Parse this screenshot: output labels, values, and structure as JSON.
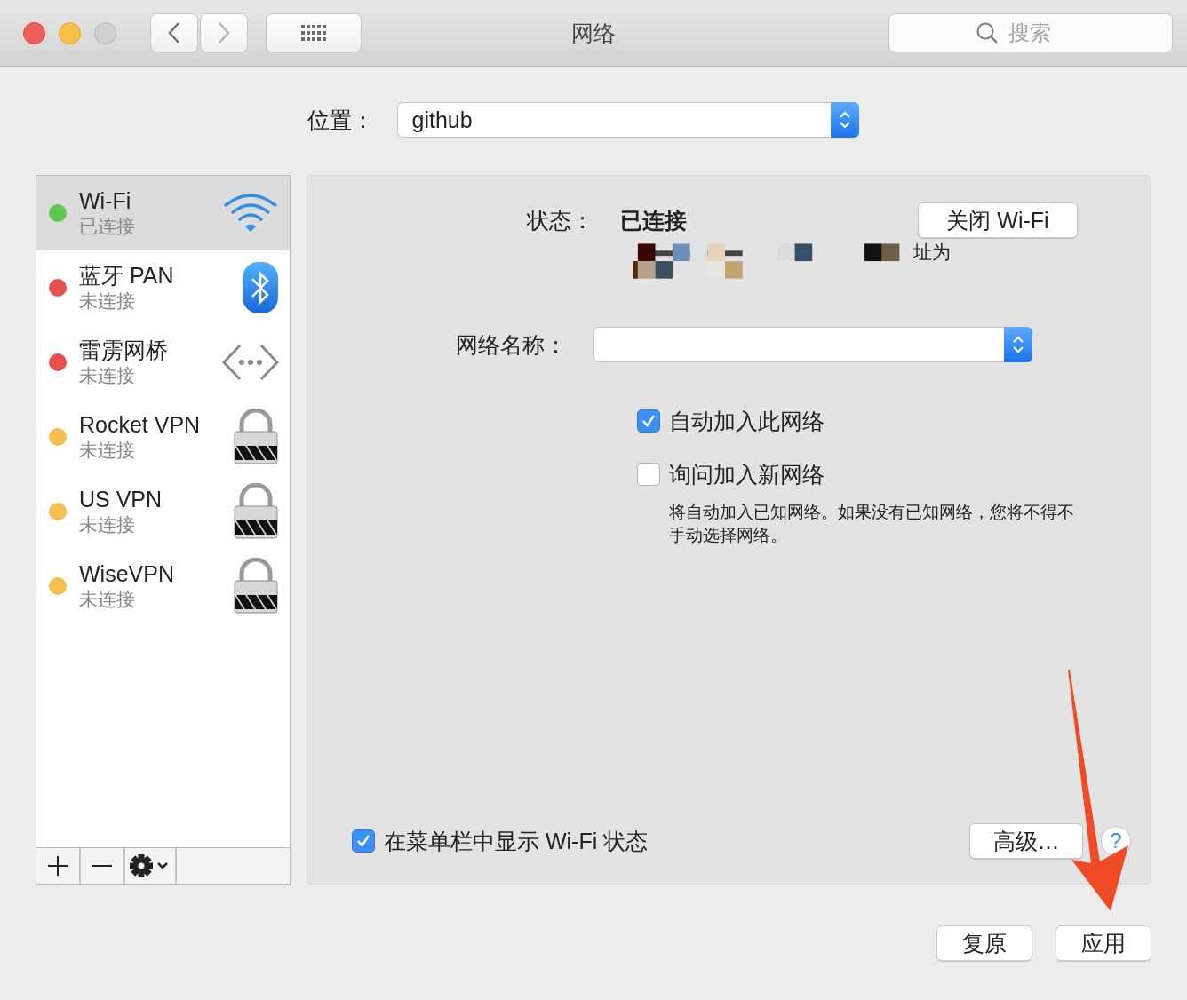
{
  "window": {
    "title": "网络"
  },
  "search": {
    "placeholder": "搜索"
  },
  "location": {
    "label": "位置：",
    "value": "github"
  },
  "services": [
    {
      "name": "Wi-Fi",
      "status": "已连接",
      "color": "#5ec452",
      "kind": "wifi",
      "selected": true
    },
    {
      "name": "蓝牙 PAN",
      "status": "未连接",
      "color": "#e9504b",
      "kind": "bluetooth",
      "selected": false
    },
    {
      "name": "雷雳网桥",
      "status": "未连接",
      "color": "#e9504b",
      "kind": "bridge",
      "selected": false
    },
    {
      "name": "Rocket VPN",
      "status": "未连接",
      "color": "#f5be4f",
      "kind": "vpn",
      "selected": false
    },
    {
      "name": "US VPN",
      "status": "未连接",
      "color": "#f5be4f",
      "kind": "vpn",
      "selected": false
    },
    {
      "name": "WiseVPN",
      "status": "未连接",
      "color": "#f5be4f",
      "kind": "vpn",
      "selected": false
    }
  ],
  "detail": {
    "status_label": "状态：",
    "status_value": "已连接",
    "toggle_button": "关闭 Wi-Fi",
    "status_note": "址为",
    "network_name_label": "网络名称：",
    "options": [
      {
        "label": "自动加入此网络",
        "checked": true
      },
      {
        "label": "询问加入新网络",
        "checked": false
      }
    ],
    "hint": "将自动加入已知网络。如果没有已知网络，您将不得不手动选择网络。",
    "menu_bar_option": {
      "label": "在菜单栏中显示 Wi-Fi 状态",
      "checked": true
    },
    "advanced_button": "高级…",
    "help_button": "?"
  },
  "buttons": [
    {
      "label": "复原"
    },
    {
      "label": "应用"
    }
  ]
}
